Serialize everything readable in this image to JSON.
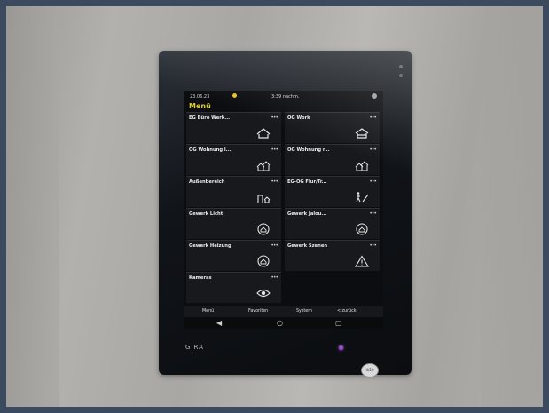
{
  "status_bar": {
    "date": "23.06.23",
    "time": "3:39 nachm."
  },
  "screen_title": "Menü",
  "tiles": [
    {
      "label": "EG Büro Werk...",
      "icon": "house-roof-icon"
    },
    {
      "label": "OG Work",
      "icon": "house-roof-icon"
    },
    {
      "label": "OG Wohnung l...",
      "icon": "houses-icon"
    },
    {
      "label": "OG Wohnung r...",
      "icon": "houses-icon"
    },
    {
      "label": "Außenbereich",
      "icon": "garden-icon"
    },
    {
      "label": "EG-OG Flur/Tr...",
      "icon": "stairs-person-icon"
    },
    {
      "label": "Gewerk Licht",
      "icon": "circle-house-icon"
    },
    {
      "label": "Gewerk Jalou...",
      "icon": "circle-house-icon"
    },
    {
      "label": "Gewerk Heizung",
      "icon": "circle-house-icon"
    },
    {
      "label": "Gewerk Szenen",
      "icon": "warning-triangle-icon"
    },
    {
      "label": "Kameras",
      "icon": "eye-icon"
    }
  ],
  "more_glyph": "•••",
  "bottom_nav": {
    "menu": "Menü",
    "favorites": "Favoriten",
    "system": "System",
    "back": "< zurück"
  },
  "system_bar": {
    "back": "◀",
    "home": "○",
    "recent": "▢"
  },
  "brand": "GIRA",
  "sticker_text": "4/20"
}
